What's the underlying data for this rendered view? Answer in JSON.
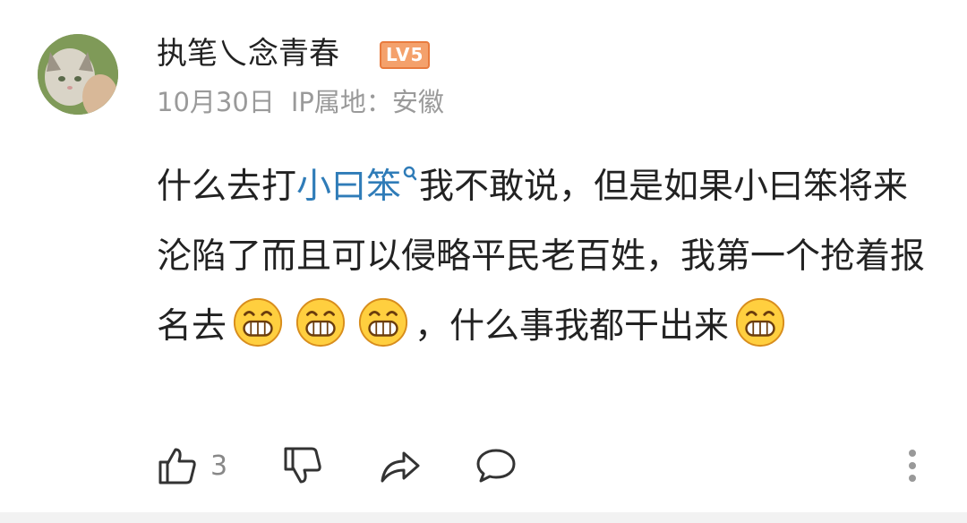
{
  "comment": {
    "username": "执笔乀念青春",
    "level_badge": "LV5",
    "date": "10月30日",
    "ip_location": "IP属地：安徽",
    "text_part1": "什么去打",
    "link_text": "小曰笨",
    "text_part2": "我不敢说，但是如果小曰笨将来沦陷了而且可以侵略平民老百姓，我第一个抢着报名去",
    "text_part3": "，什么事我都干出来",
    "like_count": "3"
  },
  "colors": {
    "link": "#2f7cb8",
    "level_badge": "#f4a16c",
    "meta": "#9a9a9a"
  },
  "icons": {
    "like": "thumbs-up-icon",
    "dislike": "thumbs-down-icon",
    "share": "share-arrow-icon",
    "reply": "comment-bubble-icon",
    "more": "vertical-dots-icon",
    "emoji": "grinning-face-emoji"
  }
}
